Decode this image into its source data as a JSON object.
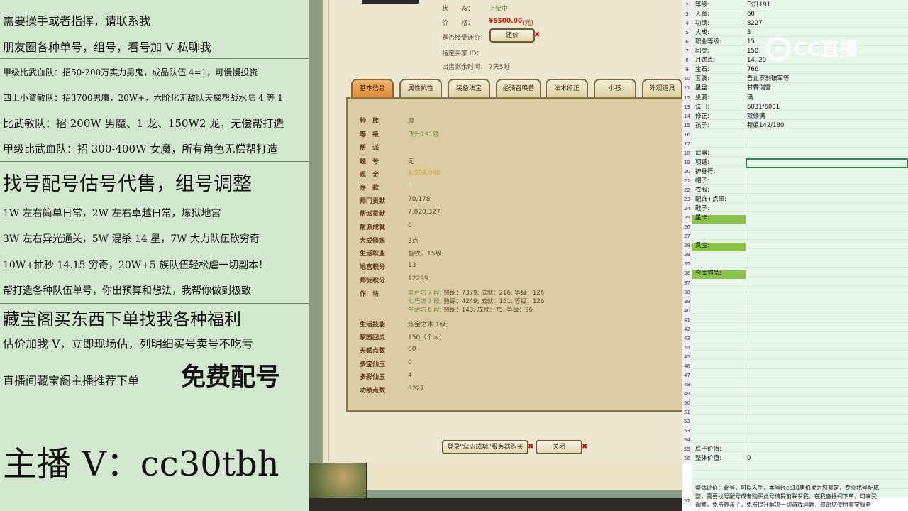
{
  "left": {
    "lines": [
      "需要操手或者指挥，请联系我",
      "朋友圈各种单号，组号，看号加 V 私聊我",
      "甲级比武血队：招50-200万实力男鬼，成品队伍 4=1，可慢慢投资",
      "四上小资敏队：招3700男魔，20W+，六阶化无敌队天梯帮战水陆 4 等 1",
      "比武敏队：招 200W 男魔、1 龙、150W2 龙，无偿帮打造",
      "甲级比武血队：招 300-400W 女魔，所有角色无偿帮打造",
      "找号配号估号代售，组号调整",
      "1W 左右简单日常，2W 左右卓越日常，炼狱地宫",
      "3W 左右异光通关，5W 混杀 14 星，7W 大力队伍砍穷奇",
      "10W+抽秒 14.15 穷奇，20W+5 族队伍轻松虐一切副本！",
      "帮打造各种队伍单号，你出预算和想法，我帮你做到极致",
      "藏宝阁买东西下单找我各种福利",
      "估价加我 V，立即现场估，列明细买号卖号不吃亏",
      "直播间藏宝阁主播推荐下单",
      "免费配号",
      "主播 V：cc30tbh"
    ]
  },
  "game": {
    "status_label": "状　　态：",
    "status_value": "上架中",
    "price_label": "价　　格：",
    "price_value": "¥5500.00",
    "price_unit": "(元)",
    "bargain_label": "是否接受还价：",
    "bargain_button": "还价",
    "buyer_label": "指定买家 ID：",
    "remain_label": "出售剩余时间：",
    "remain_value": "7天5时",
    "tabs": [
      "基本信息",
      "属性抗性",
      "装备法宝",
      "坐骑召唤兽",
      "法术修正",
      "小孩",
      "外观道具"
    ],
    "rows": [
      {
        "k": "种　族",
        "v": "魔"
      },
      {
        "k": "等　级",
        "v": "飞升191级"
      },
      {
        "k": "帮　派",
        "v": ""
      },
      {
        "k": "题　号",
        "v": "无"
      },
      {
        "k": "现　金",
        "v": "4,984,080"
      },
      {
        "k": "存　款",
        "v": "0"
      },
      {
        "k": "师门贡献",
        "v": "70,178"
      },
      {
        "k": "帮派贡献",
        "v": "7,820,327"
      },
      {
        "k": "帮派成就",
        "v": "0"
      },
      {
        "k": "大成修炼",
        "v": "3点"
      },
      {
        "k": "生活职业",
        "v": "畜牧，15级"
      },
      {
        "k": "地宫积分",
        "v": "13"
      },
      {
        "k": "师徒积分",
        "v": "12299"
      },
      {
        "k": "作　坊",
        "v": ""
      },
      {
        "k": "生活技能",
        "v": "炼金之术 1级;"
      },
      {
        "k": "家园回灵",
        "v": "150（个人）"
      },
      {
        "k": "天赋点数",
        "v": "60"
      },
      {
        "k": "多宝仙玉",
        "v": "0"
      },
      {
        "k": "多彩仙玉",
        "v": "4"
      },
      {
        "k": "功绩点数",
        "v": "8227"
      }
    ],
    "workshop": [
      {
        "name": "匿卢坊 7 段;",
        "a": "熟练：",
        "av": "7379;",
        "b": "成就：",
        "bv": "216;",
        "c": "等级：",
        "cv": "126"
      },
      {
        "name": "七巧坊 7 段;",
        "a": "熟练：",
        "av": "4249;",
        "b": "成就：",
        "bv": "151;",
        "c": "等级：",
        "cv": "126"
      },
      {
        "name": "生活坊 6 段;",
        "a": "熟练：",
        "av": "143;",
        "b": "成就：",
        "bv": "75;",
        "c": "等级：",
        "cv": "96"
      }
    ],
    "login_button": "登录\"众志成城\"服务器购买",
    "close_button": "关闭"
  },
  "sheet": {
    "rows": [
      {
        "n": "2",
        "a": "等级:",
        "b": "飞升191"
      },
      {
        "n": "3",
        "a": "天赋:",
        "b": "60"
      },
      {
        "n": "4",
        "a": "功绩:",
        "b": "8227"
      },
      {
        "n": "5",
        "a": "大成:",
        "b": "3"
      },
      {
        "n": "6",
        "a": "职业等级:",
        "b": "15"
      },
      {
        "n": "7",
        "a": "回灵:",
        "b": "150"
      },
      {
        "n": "8",
        "a": "月饼点:",
        "b": "14, 20"
      },
      {
        "n": "9",
        "a": "宝石:",
        "b": "766"
      },
      {
        "n": "10",
        "a": "套装:",
        "b": "吾止罗刹破军等"
      },
      {
        "n": "11",
        "a": "星盘:",
        "b": "甘霖瑞雪"
      },
      {
        "n": "12",
        "a": "坐骑:",
        "b": "满"
      },
      {
        "n": "13",
        "a": "法门:",
        "b": "6031/6001"
      },
      {
        "n": "14",
        "a": "修正:",
        "b": "双修满"
      },
      {
        "n": "15",
        "a": "孩子:",
        "b": "新娘142/180"
      },
      {
        "n": "16",
        "a": "",
        "b": ""
      },
      {
        "n": "17",
        "a": "",
        "b": ""
      },
      {
        "n": "18",
        "a": "武器:",
        "b": ""
      },
      {
        "n": "19",
        "a": "项链:",
        "b": ""
      },
      {
        "n": "20",
        "a": "护身符:",
        "b": ""
      },
      {
        "n": "21",
        "a": "帽子:",
        "b": ""
      },
      {
        "n": "22",
        "a": "衣服:",
        "b": ""
      },
      {
        "n": "23",
        "a": "配饰+点翠:",
        "b": ""
      },
      {
        "n": "24",
        "a": "鞋子:",
        "b": ""
      },
      {
        "n": "25",
        "a": "星卡:",
        "b": ""
      },
      {
        "n": "26",
        "a": "",
        "b": ""
      },
      {
        "n": "27",
        "a": "",
        "b": ""
      },
      {
        "n": "28",
        "a": "灵宝:",
        "b": ""
      },
      {
        "n": "29",
        "a": "",
        "b": ""
      },
      {
        "n": "35",
        "a": "",
        "b": ""
      },
      {
        "n": "36",
        "a": "仓库物品:",
        "b": ""
      },
      {
        "n": "37",
        "a": "",
        "b": ""
      },
      {
        "n": "38",
        "a": "",
        "b": ""
      },
      {
        "n": "39",
        "a": "",
        "b": ""
      },
      {
        "n": "40",
        "a": "",
        "b": ""
      },
      {
        "n": "41",
        "a": "",
        "b": ""
      },
      {
        "n": "42",
        "a": "",
        "b": ""
      },
      {
        "n": "43",
        "a": "",
        "b": ""
      },
      {
        "n": "44",
        "a": "",
        "b": ""
      },
      {
        "n": "45",
        "a": "",
        "b": ""
      },
      {
        "n": "46",
        "a": "",
        "b": ""
      },
      {
        "n": "47",
        "a": "",
        "b": ""
      },
      {
        "n": "48",
        "a": "",
        "b": ""
      },
      {
        "n": "49",
        "a": "",
        "b": ""
      },
      {
        "n": "50",
        "a": "",
        "b": ""
      },
      {
        "n": "51",
        "a": "",
        "b": ""
      },
      {
        "n": "52",
        "a": "",
        "b": ""
      },
      {
        "n": "53",
        "a": "",
        "b": ""
      },
      {
        "n": "54",
        "a": "",
        "b": ""
      },
      {
        "n": "55",
        "a": "底子价值:",
        "b": ""
      },
      {
        "n": "56",
        "a": "整体价值:",
        "b": "0"
      }
    ],
    "note_row": "57",
    "note_lines": [
      "整体评价：此号，可以入手，本号经cc30唐伯虎为您鉴定，专业找号配成",
      "整，需要找号配号或者购买此号请提前联系我，在我直播间下单，可享受",
      "调整，免费养孩子，免费提升解决一切游戏问题，感谢您使用鉴宝服务"
    ],
    "logo_text": "CC直播"
  }
}
